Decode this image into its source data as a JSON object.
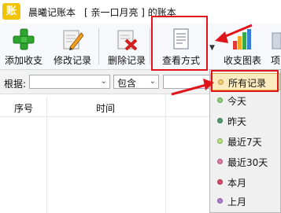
{
  "window": {
    "app_icon_glyph": "账",
    "app_name": "晨曦记账本",
    "document_title": "[ 亲一口月亮 ] 的账本"
  },
  "toolbar": {
    "buttons": [
      {
        "label": "添加收支",
        "icon": "green-plus-icon"
      },
      {
        "label": "修改记录",
        "icon": "edit-pencil-icon"
      },
      {
        "label": "删除记录",
        "icon": "delete-x-icon"
      },
      {
        "label": "查看方式",
        "icon": "document-view-icon"
      },
      {
        "label": "收支图表",
        "icon": "bar-chart-icon"
      },
      {
        "label": "项",
        "icon": "truncated-icon"
      }
    ]
  },
  "filter": {
    "label": "根据:",
    "field_value": "",
    "operator_value": "包含",
    "keyword_value": ""
  },
  "list": {
    "columns": [
      "序号",
      "时间"
    ]
  },
  "view_menu": {
    "items": [
      {
        "label": "所有记录",
        "color": "#f5d06a",
        "selected": true
      },
      {
        "label": "今天",
        "color": "#8bd17a"
      },
      {
        "label": "昨天",
        "color": "#4f9b6e"
      },
      {
        "label": "最近7天",
        "color": "#b7e27a"
      },
      {
        "label": "最近30天",
        "color": "#e07aa0"
      },
      {
        "label": "本月",
        "color": "#d94b6a"
      },
      {
        "label": "上月",
        "color": "#b07ad1"
      }
    ]
  },
  "colors": {
    "annotation": "#e0151b",
    "highlight_bg": "#fcebbf"
  }
}
